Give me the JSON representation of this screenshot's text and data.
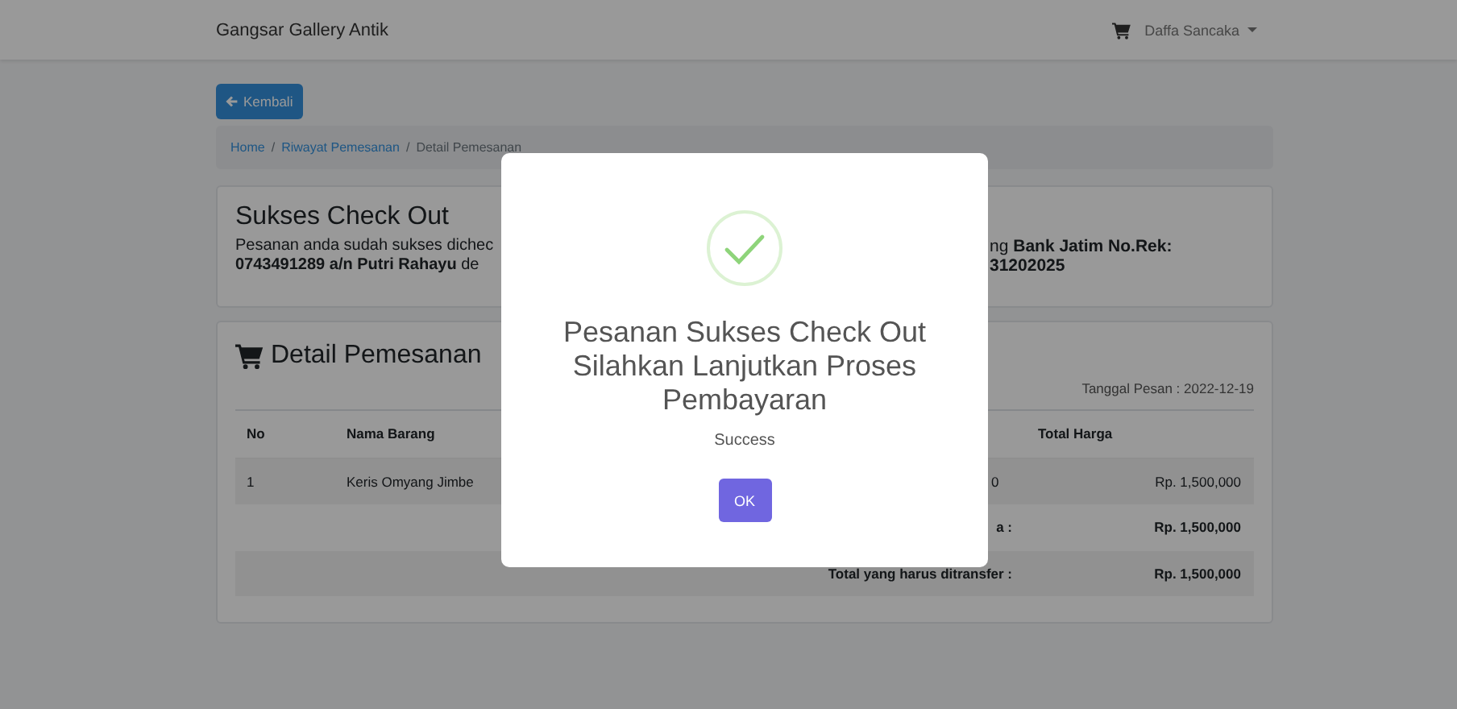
{
  "navbar": {
    "brand": "Gangsar Gallery Antik",
    "user": "Daffa Sancaka"
  },
  "back_button": {
    "label": "Kembali"
  },
  "breadcrumb": {
    "separator": "/",
    "items": [
      {
        "label": "Home",
        "kind": "link"
      },
      {
        "label": "Riwayat Pemesanan",
        "kind": "link"
      },
      {
        "label": "Detail Pemesanan",
        "kind": "current"
      }
    ]
  },
  "checkout_card": {
    "title": "Sukses Check Out",
    "left_lines": [
      "Pesanan anda sudah sukses dichec",
      "**0743491289 a/n Putri Rahayu** de"
    ],
    "right_lines": [
      "ng **Bank Jatim No.Rek:**",
      "**31202025**"
    ]
  },
  "order_card": {
    "title": "Detail Pemesanan",
    "date": "Tanggal Pesan : 2022-12-19",
    "columns": [
      "No",
      "Nama Barang",
      "Total Harga"
    ],
    "rows": [
      {
        "no": "1",
        "name": "Keris Omyang Jimbe",
        "column_3": "0",
        "total": "Rp. 1,500,000"
      }
    ],
    "summary": [
      {
        "label": "a :",
        "value": "Rp. 1,500,000"
      },
      {
        "label": "Total yang harus ditransfer :",
        "value": "Rp. 1,500,000"
      }
    ]
  },
  "modal": {
    "title": "Pesanan Sukses Check Out Silahkan Lanjutkan Proses Pembayaran",
    "text": "Success",
    "button": "OK"
  }
}
